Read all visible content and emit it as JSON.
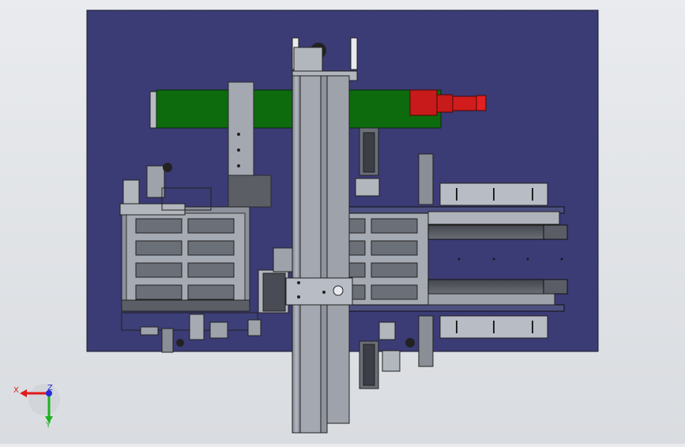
{
  "viewport": {
    "background": "#e3e5e8",
    "base_plate_color": "#3b3b75",
    "frame_color": "#9aa0ab",
    "rail_color": "#8e939d",
    "cylinder_green": "#0d6b0d",
    "motor_red": "#c81a1a",
    "dark_part_color": "#4a4c55"
  },
  "triad": {
    "x_label": "X",
    "y_label": "Y",
    "z_label": "Z",
    "x_color": "#e01b1b",
    "y_color": "#1fb11f",
    "z_color": "#2a2ad8"
  }
}
